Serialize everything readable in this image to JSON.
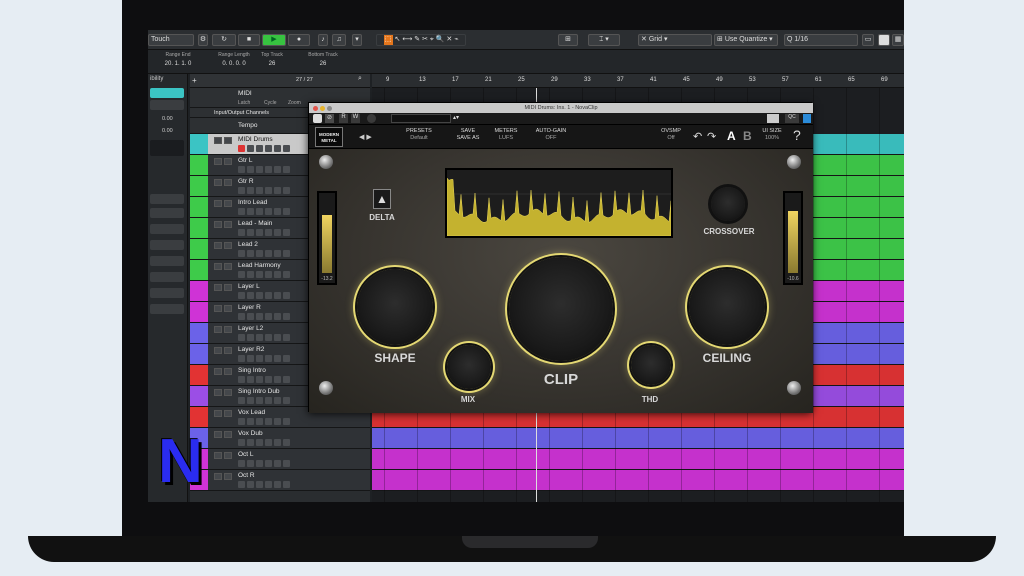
{
  "toolbar": {
    "mode_label": "Touch",
    "grid_label": "Grid",
    "quantize_label": "Use Quantize",
    "quantize_value": "1/16"
  },
  "info": {
    "cols": [
      {
        "label": "Range End",
        "value": "20. 1. 1. 0"
      },
      {
        "label": "Range Length",
        "value": "0. 0. 0. 0"
      },
      {
        "label": "Top Track",
        "value": "26"
      },
      {
        "label": "Bottom Track",
        "value": "26"
      }
    ]
  },
  "inspector": {
    "title": "ibility",
    "values": [
      "0.00",
      "0.00"
    ]
  },
  "tracklist": {
    "counter": "27 / 27",
    "midi_folder": "MIDI",
    "io_channels": "Input/Output Channels",
    "tempo": "Tempo",
    "midi_sub": [
      "Latch",
      "Cycle",
      "Zoom"
    ]
  },
  "tracks": [
    {
      "name": "MIDI Drums",
      "color": "#3bc4c4"
    },
    {
      "name": "Gtr L",
      "color": "#3ecb4a"
    },
    {
      "name": "Gtr R",
      "color": "#3ecb4a"
    },
    {
      "name": "Intro Lead",
      "color": "#3ecb4a"
    },
    {
      "name": "Lead - Main",
      "color": "#3ecb4a"
    },
    {
      "name": "Lead 2",
      "color": "#3ecb4a"
    },
    {
      "name": "Lead Harmony",
      "color": "#3ecb4a"
    },
    {
      "name": "Layer L",
      "color": "#cf33d6"
    },
    {
      "name": "Layer R",
      "color": "#cf33d6"
    },
    {
      "name": "Layer L2",
      "color": "#6b62e8"
    },
    {
      "name": "Layer R2",
      "color": "#6b62e8"
    },
    {
      "name": "Sing Intro",
      "color": "#e23333"
    },
    {
      "name": "Sing Intro Dub",
      "color": "#9b4ee6"
    },
    {
      "name": "Vox Lead",
      "color": "#e23333"
    },
    {
      "name": "Vox Dub",
      "color": "#6b62e8"
    },
    {
      "name": "Oct L",
      "color": "#cf33d6"
    },
    {
      "name": "Oct R",
      "color": "#cf33d6"
    }
  ],
  "ruler": [
    "9",
    "13",
    "17",
    "21",
    "25",
    "29",
    "33",
    "37",
    "41",
    "45",
    "49",
    "53",
    "57",
    "61",
    "65",
    "69"
  ],
  "plugin": {
    "window_title": "MIDI Drums: Ins. 1 - NovaClip",
    "brand": "MODERN METAL",
    "presets_label": "PRESETS",
    "presets_value": "Default",
    "save_label": "SAVE",
    "save_as_label": "SAVE AS",
    "meters_label": "METERS",
    "meters_value": "LUFS",
    "autogain_label": "AUTO-GAIN",
    "autogain_value": "OFF",
    "ovsmp_label": "OVSMP",
    "ovsmp_value": "Off",
    "a_label": "A",
    "b_label": "B",
    "uisize_label": "UI SIZE",
    "uisize_value": "100%",
    "help": "?",
    "delta": "DELTA",
    "crossover": "CROSSOVER",
    "shape": "SHAPE",
    "clip": "CLIP",
    "ceiling": "CEILING",
    "mix": "MIX",
    "thd": "THD",
    "meter_left_value": "-13.2",
    "meter_right_value": "-10.6",
    "meter_left_level": 0.78,
    "meter_right_level": 0.84
  },
  "colors": {
    "accent": "#e4d873",
    "waveform": "#d4c33a"
  }
}
